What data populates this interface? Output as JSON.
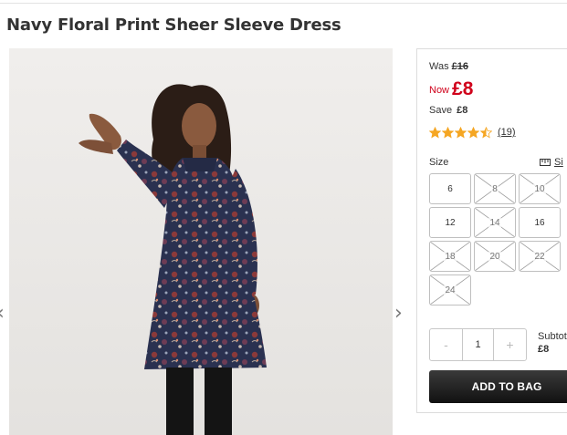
{
  "product": {
    "title": "Navy Floral Print Sheer Sleeve Dress",
    "image_alt_icon": "model-photo"
  },
  "pricing": {
    "was_label": "Was",
    "was_price": "£16",
    "now_label": "Now",
    "now_price": "£8",
    "save_label": "Save",
    "save_amount": "£8",
    "price_color": "#d0021b"
  },
  "rating": {
    "stars": 4.5,
    "max_stars": 5,
    "review_count": "(19)",
    "star_color": "#f5a623"
  },
  "size": {
    "label": "Size",
    "guide_label": "Si",
    "guide_icon": "ruler-icon",
    "options": [
      {
        "label": "6",
        "available": true
      },
      {
        "label": "8",
        "available": false
      },
      {
        "label": "10",
        "available": false
      },
      {
        "label": "12",
        "available": true
      },
      {
        "label": "14",
        "available": false
      },
      {
        "label": "16",
        "available": true
      },
      {
        "label": "18",
        "available": false
      },
      {
        "label": "20",
        "available": false
      },
      {
        "label": "22",
        "available": false
      },
      {
        "label": "24",
        "available": false
      }
    ]
  },
  "quantity": {
    "minus": "-",
    "value": "1",
    "plus": "+"
  },
  "subtotal": {
    "label": "Subtot",
    "value": "£8"
  },
  "actions": {
    "add_to_bag": "ADD TO BAG"
  },
  "gallery": {
    "prev": "‹",
    "next": "›"
  }
}
